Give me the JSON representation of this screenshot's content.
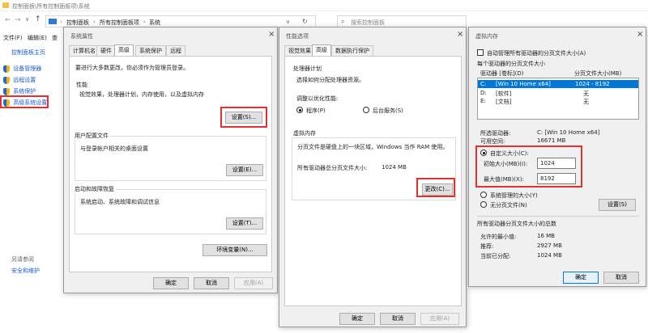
{
  "window": {
    "title": "控制面板\\所有控制面板项\\系统"
  },
  "addressbar": {
    "path": [
      "控制面板",
      "所有控制面板项",
      "系统"
    ],
    "search_placeholder": "搜索控制面板"
  },
  "menubar": {
    "file": "文件(F)",
    "edit": "编辑(E)",
    "view": "查"
  },
  "left_panel": {
    "home": "控制面板主页",
    "links": [
      "设备管理器",
      "远程设置",
      "系统保护",
      "高级系统设置"
    ],
    "see_also": "另请参阅",
    "security": "安全和维护"
  },
  "sysprops": {
    "title": "系统属性",
    "tabs": [
      "计算机名",
      "硬件",
      "高级",
      "系统保护",
      "远程"
    ],
    "admin_note": "要进行大多数更改，你必须作为管理员登录。",
    "performance": {
      "label": "性能",
      "desc": "视觉效果，处理器计划，内存使用，以及虚拟内存",
      "button": "设置(S)..."
    },
    "profiles": {
      "label": "用户配置文件",
      "desc": "与登录帐户相关的桌面设置",
      "button": "设置(E)..."
    },
    "startup": {
      "label": "启动和故障恢复",
      "desc": "系统启动、系统故障和调试信息",
      "button": "设置(T)..."
    },
    "env_button": "环境变量(N)...",
    "ok": "确定",
    "cancel": "取消",
    "apply": "应用(A)"
  },
  "perfopts": {
    "title": "性能选项",
    "tabs": [
      "视觉效果",
      "高级",
      "数据执行保护"
    ],
    "sched": {
      "label": "处理器计划",
      "desc": "选择如何分配处理器资源。",
      "adjust": "调整以优化性能:",
      "programs": "程序(P)",
      "background": "后台服务(S)"
    },
    "vm": {
      "label": "虚拟内存",
      "desc": "分页文件是硬盘上的一块区域，Windows 当作 RAM 使用。",
      "total_label": "所有驱动器总分页文件大小:",
      "total_value": "1024 MB",
      "change_button": "更改(C)..."
    },
    "ok": "确定",
    "cancel": "取消",
    "apply": "应用(A)"
  },
  "vmdlg": {
    "title": "虚拟内存",
    "auto_label": "自动管理所有驱动器的分页文件大小(A)",
    "per_drive_label": "每个驱动器的分页文件大小",
    "col_drive": "驱动器 [卷标](D)",
    "col_size": "分页文件大小(MB)",
    "drives": [
      {
        "drive": "C:",
        "label": "[Win 10 Home x64]",
        "size": "1024 - 8192"
      },
      {
        "drive": "D:",
        "label": "[软件]",
        "size": "无"
      },
      {
        "drive": "E:",
        "label": "[文档]",
        "size": "无"
      }
    ],
    "selected_drive_label": "所选驱动器:",
    "selected_drive_value": "C:  [Win 10 Home x64]",
    "free_label": "可用空间:",
    "free_value": "16671 MB",
    "custom_label": "自定义大小(C):",
    "initial_label": "初始大小(MB)(I):",
    "initial_value": "1024",
    "max_label": "最大值(MB)(X):",
    "max_value": "8192",
    "system_managed": "系统管理的大小(Y)",
    "no_paging": "无分页文件(N)",
    "set_button": "设置(S)",
    "totals_label": "所有驱动器分页文件大小的总数",
    "min_label": "允许的最小值:",
    "min_value": "16 MB",
    "rec_label": "推荐:",
    "rec_value": "2927 MB",
    "cur_label": "当前已分配:",
    "cur_value": "1024 MB",
    "ok": "确定",
    "cancel": "取消"
  }
}
